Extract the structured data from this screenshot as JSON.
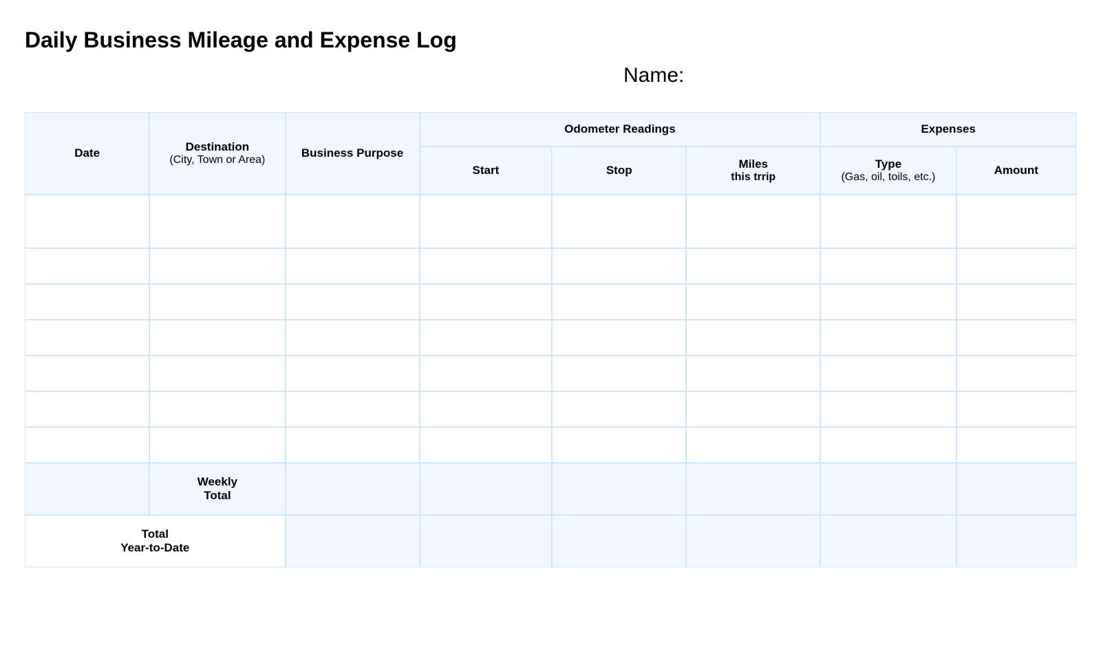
{
  "title": "Daily Business Mileage and Expense Log",
  "name_label": "Name:",
  "columns": {
    "date": "Date",
    "destination_main": "Destination",
    "destination_sub": "(City, Town or Area)",
    "purpose": "Business Purpose",
    "odometer_group": "Odometer Readings",
    "start": "Start",
    "stop": "Stop",
    "miles_main": "Miles",
    "miles_sub": "this trrip",
    "expenses_group": "Expenses",
    "type_main": "Type",
    "type_sub": "(Gas, oil, toils, etc.)",
    "amount": "Amount"
  },
  "rows": [
    {
      "date": "",
      "destination": "",
      "purpose": "",
      "start": "",
      "stop": "",
      "miles": "",
      "type": "",
      "amount": ""
    },
    {
      "date": "",
      "destination": "",
      "purpose": "",
      "start": "",
      "stop": "",
      "miles": "",
      "type": "",
      "amount": ""
    },
    {
      "date": "",
      "destination": "",
      "purpose": "",
      "start": "",
      "stop": "",
      "miles": "",
      "type": "",
      "amount": ""
    },
    {
      "date": "",
      "destination": "",
      "purpose": "",
      "start": "",
      "stop": "",
      "miles": "",
      "type": "",
      "amount": ""
    },
    {
      "date": "",
      "destination": "",
      "purpose": "",
      "start": "",
      "stop": "",
      "miles": "",
      "type": "",
      "amount": ""
    },
    {
      "date": "",
      "destination": "",
      "purpose": "",
      "start": "",
      "stop": "",
      "miles": "",
      "type": "",
      "amount": ""
    },
    {
      "date": "",
      "destination": "",
      "purpose": "",
      "start": "",
      "stop": "",
      "miles": "",
      "type": "",
      "amount": ""
    }
  ],
  "summary": {
    "weekly_label_line1": "Weekly",
    "weekly_label_line2": "Total",
    "ytd_line1": "Total",
    "ytd_line2": "Year-to-Date"
  }
}
